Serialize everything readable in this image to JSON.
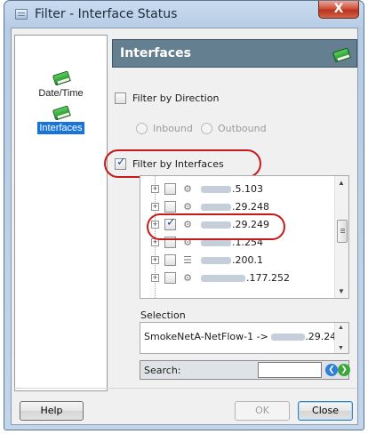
{
  "window": {
    "title": "Filter - Interface Status",
    "close_glyph": "X"
  },
  "nav": {
    "items": [
      {
        "label": "Date/Time",
        "icon": "green-book-icon",
        "selected": false
      },
      {
        "label": "Interfaces",
        "icon": "green-book-icon",
        "selected": true
      }
    ]
  },
  "panel": {
    "title": "Interfaces"
  },
  "filters": {
    "direction": {
      "label": "Filter by Direction",
      "checked": false
    },
    "inbound": {
      "label": "Inbound",
      "enabled": false
    },
    "outbound": {
      "label": "Outbound",
      "enabled": false
    },
    "interfaces": {
      "label": "Filter by Interfaces",
      "checked": true
    }
  },
  "tree": {
    "rows": [
      {
        "address": ".5.103",
        "checked": false,
        "icon": "interface-icon"
      },
      {
        "address": ".29.248",
        "checked": false,
        "icon": "interface-icon"
      },
      {
        "address": ".29.249",
        "checked": true,
        "icon": "interface-icon"
      },
      {
        "address": ".1.254",
        "checked": false,
        "icon": "interface-icon"
      },
      {
        "address": ".200.1",
        "checked": false,
        "icon": "switch-icon"
      },
      {
        "address": ".177.252",
        "checked": false,
        "icon": "interface-icon"
      }
    ]
  },
  "selection": {
    "label": "Selection",
    "prefix": "SmokeNetA-NetFlow-1 -> ",
    "suffix": ".29.249"
  },
  "search": {
    "label": "Search:",
    "value": ""
  },
  "buttons": {
    "help": "Help",
    "ok": "OK",
    "close": "Close"
  },
  "colors": {
    "header": "#647f8f",
    "highlight_oval": "#c81a1a",
    "nav_selected": "#1874d8"
  }
}
